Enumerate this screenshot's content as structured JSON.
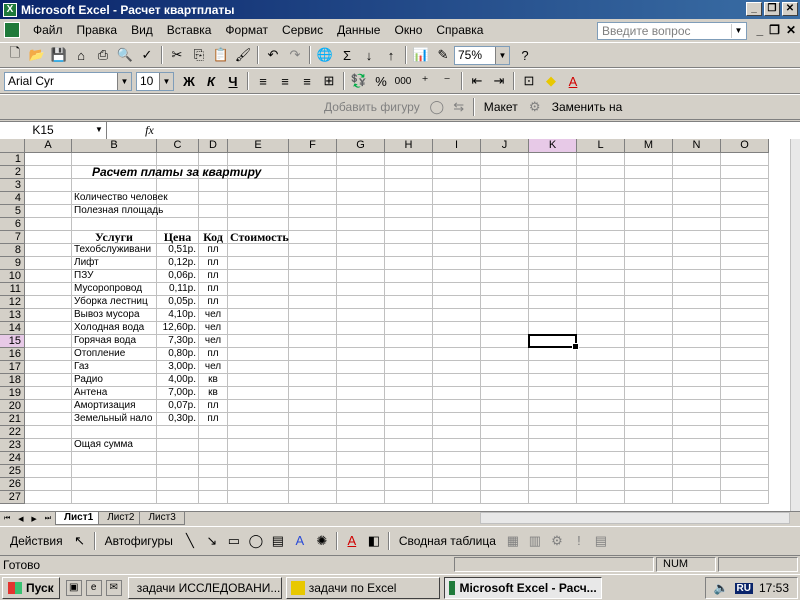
{
  "window": {
    "title": "Microsoft Excel - Расчет квартплаты"
  },
  "menu": {
    "items": [
      "Файл",
      "Правка",
      "Вид",
      "Вставка",
      "Формат",
      "Сервис",
      "Данные",
      "Окно",
      "Справка"
    ],
    "help_placeholder": "Введите вопрос"
  },
  "toolbar": {
    "zoom": "75%",
    "font_name": "Arial Cyr",
    "font_size": "10",
    "bold": "Ж",
    "italic": "К",
    "underline": "Ч",
    "percent": "%",
    "thousands": "000",
    "add_shape": "Добавить фигуру",
    "layout": "Макет",
    "replace": "Заменить на"
  },
  "formula": {
    "name_box": "K15",
    "fx": "fx",
    "content": ""
  },
  "columns": [
    "A",
    "B",
    "C",
    "D",
    "E",
    "F",
    "G",
    "H",
    "I",
    "J",
    "K",
    "L",
    "M",
    "N",
    "O"
  ],
  "active_cell": "K15",
  "rows": [
    {
      "n": "1",
      "b": "",
      "c": "",
      "d": "",
      "e": ""
    },
    {
      "n": "2",
      "b": "Расчет платы за квартиру",
      "c": "",
      "d": "",
      "e": ""
    },
    {
      "n": "3",
      "b": "",
      "c": "",
      "d": "",
      "e": ""
    },
    {
      "n": "4",
      "b": "Количество человек",
      "c": "",
      "d": "",
      "e": ""
    },
    {
      "n": "5",
      "b": "Полезная площадь",
      "c": "",
      "d": "",
      "e": ""
    },
    {
      "n": "6",
      "b": "",
      "c": "",
      "d": "",
      "e": ""
    },
    {
      "n": "7",
      "b": "Услуги",
      "c": "Цена",
      "d": "Код",
      "e": "Стоимость"
    },
    {
      "n": "8",
      "b": "Техобслуживани",
      "c": "0,51р.",
      "d": "пл",
      "e": ""
    },
    {
      "n": "9",
      "b": "Лифт",
      "c": "0,12р.",
      "d": "пл",
      "e": ""
    },
    {
      "n": "10",
      "b": "ПЗУ",
      "c": "0,06р.",
      "d": "пл",
      "e": ""
    },
    {
      "n": "11",
      "b": "Мусоропровод",
      "c": "0,11р.",
      "d": "пл",
      "e": ""
    },
    {
      "n": "12",
      "b": "Уборка лестниц",
      "c": "0,05р.",
      "d": "пл",
      "e": ""
    },
    {
      "n": "13",
      "b": "Вывоз мусора",
      "c": "4,10р.",
      "d": "чел",
      "e": ""
    },
    {
      "n": "14",
      "b": "Холодная вода",
      "c": "12,60р.",
      "d": "чел",
      "e": ""
    },
    {
      "n": "15",
      "b": "Горячая вода",
      "c": "7,30р.",
      "d": "чел",
      "e": ""
    },
    {
      "n": "16",
      "b": "Отопление",
      "c": "0,80р.",
      "d": "пл",
      "e": ""
    },
    {
      "n": "17",
      "b": "Газ",
      "c": "3,00р.",
      "d": "чел",
      "e": ""
    },
    {
      "n": "18",
      "b": "Радио",
      "c": "4,00р.",
      "d": "кв",
      "e": ""
    },
    {
      "n": "19",
      "b": "Антена",
      "c": "7,00р.",
      "d": "кв",
      "e": ""
    },
    {
      "n": "20",
      "b": "Амортизация",
      "c": "0,07р.",
      "d": "пл",
      "e": ""
    },
    {
      "n": "21",
      "b": "Земельный нало",
      "c": "0,30р.",
      "d": "пл",
      "e": ""
    },
    {
      "n": "22",
      "b": "",
      "c": "",
      "d": "",
      "e": ""
    },
    {
      "n": "23",
      "b": "Ощая сумма",
      "c": "",
      "d": "",
      "e": ""
    },
    {
      "n": "24",
      "b": "",
      "c": "",
      "d": "",
      "e": ""
    },
    {
      "n": "25",
      "b": "",
      "c": "",
      "d": "",
      "e": ""
    },
    {
      "n": "26",
      "b": "",
      "c": "",
      "d": "",
      "e": ""
    },
    {
      "n": "27",
      "b": "",
      "c": "",
      "d": "",
      "e": ""
    }
  ],
  "sheets": [
    "Лист1",
    "Лист2",
    "Лист3"
  ],
  "drawing": {
    "actions": "Действия",
    "autoshapes": "Автофигуры",
    "pivot": "Сводная таблица"
  },
  "status": {
    "ready": "Готово",
    "num": "NUM"
  },
  "taskbar": {
    "start": "Пуск",
    "buttons": [
      "задачи  ИССЛЕДОВАНИ...",
      "задачи по Excel",
      "Microsoft Excel - Расч..."
    ],
    "lang": "RU",
    "clock": "17:53"
  }
}
